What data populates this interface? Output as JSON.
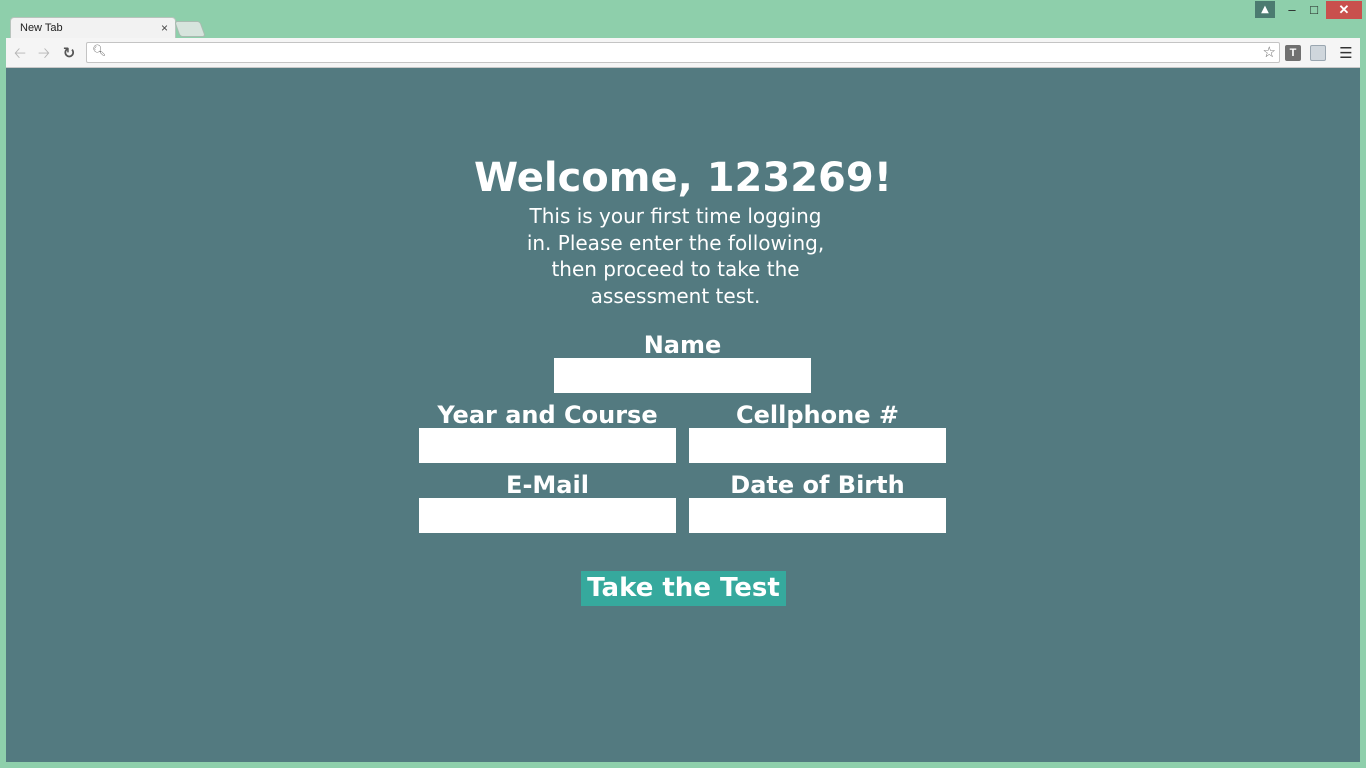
{
  "browser": {
    "tab_title": "New Tab",
    "tab_close": "×",
    "url": "",
    "window_controls": {
      "minimize": "–",
      "maximize": "□",
      "close": "✕"
    },
    "extension_label": "T",
    "icons": [
      "back-icon",
      "forward-icon",
      "reload-icon",
      "search-icon",
      "star-icon",
      "menu-icon",
      "user-icon"
    ]
  },
  "page": {
    "welcome": "Welcome, 123269!",
    "intro": "This is your first time logging in. Please enter the following, then proceed to take the assessment test.",
    "fields": {
      "name": {
        "label": "Name",
        "value": ""
      },
      "year_course": {
        "label": "Year and Course",
        "value": ""
      },
      "cellphone": {
        "label": "Cellphone #",
        "value": ""
      },
      "email": {
        "label": "E-Mail",
        "value": ""
      },
      "dob": {
        "label": "Date of Birth",
        "value": ""
      }
    },
    "submit_label": "Take the Test"
  },
  "colors": {
    "window_frame": "#8ecfab",
    "page_background": "#537a80",
    "button_background": "#36a99d",
    "close_button": "#c9504d",
    "text": "#ffffff"
  }
}
